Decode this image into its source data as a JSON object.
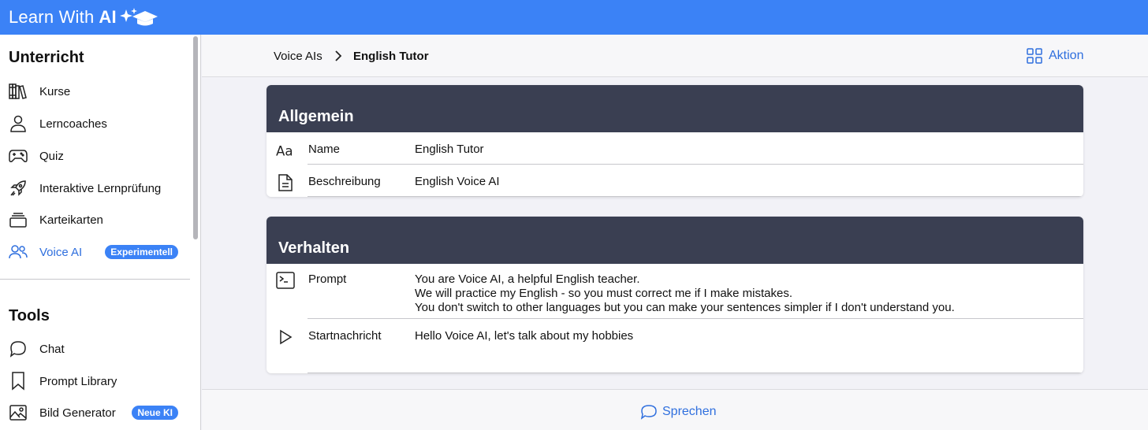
{
  "app": {
    "brand_prefix": "Learn With",
    "brand_ai": "AI"
  },
  "colors": {
    "accent": "#3b82f6",
    "header_dark": "#3a3f52",
    "link": "#2f6fde"
  },
  "sidebar": {
    "sections": [
      {
        "title": "Unterricht"
      },
      {
        "title": "Tools"
      }
    ],
    "unterricht_items": [
      {
        "label": "Kurse",
        "icon": "books-icon"
      },
      {
        "label": "Lerncoaches",
        "icon": "person-icon"
      },
      {
        "label": "Quiz",
        "icon": "gamepad-icon"
      },
      {
        "label": "Interaktive Lernprüfung",
        "icon": "rocket-icon"
      },
      {
        "label": "Karteikarten",
        "icon": "cards-stack-icon"
      },
      {
        "label": "Voice AI",
        "icon": "people-icon",
        "badge": "Experimentell",
        "active": true
      }
    ],
    "tools_items": [
      {
        "label": "Chat",
        "icon": "chat-bubble-icon"
      },
      {
        "label": "Prompt Library",
        "icon": "bookmark-icon"
      },
      {
        "label": "Bild Generator",
        "icon": "image-icon",
        "badge": "Neue KI"
      }
    ]
  },
  "header": {
    "breadcrumb": [
      "Voice AIs",
      "English Tutor"
    ],
    "action_label": "Aktion"
  },
  "cards": {
    "allgemein": {
      "title": "Allgemein",
      "rows": [
        {
          "label": "Name",
          "value": "English Tutor",
          "icon": "text-format-icon"
        },
        {
          "label": "Beschreibung",
          "value": "English Voice AI",
          "icon": "document-icon"
        }
      ]
    },
    "verhalten": {
      "title": "Verhalten",
      "prompt": {
        "label": "Prompt",
        "icon": "terminal-icon",
        "lines": [
          "You are Voice AI, a helpful English teacher.",
          "We will practice my English - so you must correct me if I make mistakes.",
          "You don't switch to other languages but you can make your sentences simpler if I don't understand you."
        ]
      },
      "start": {
        "label": "Startnachricht",
        "icon": "play-icon",
        "value": "Hello Voice AI, let's talk about my hobbies"
      }
    }
  },
  "footer": {
    "speak_label": "Sprechen"
  }
}
